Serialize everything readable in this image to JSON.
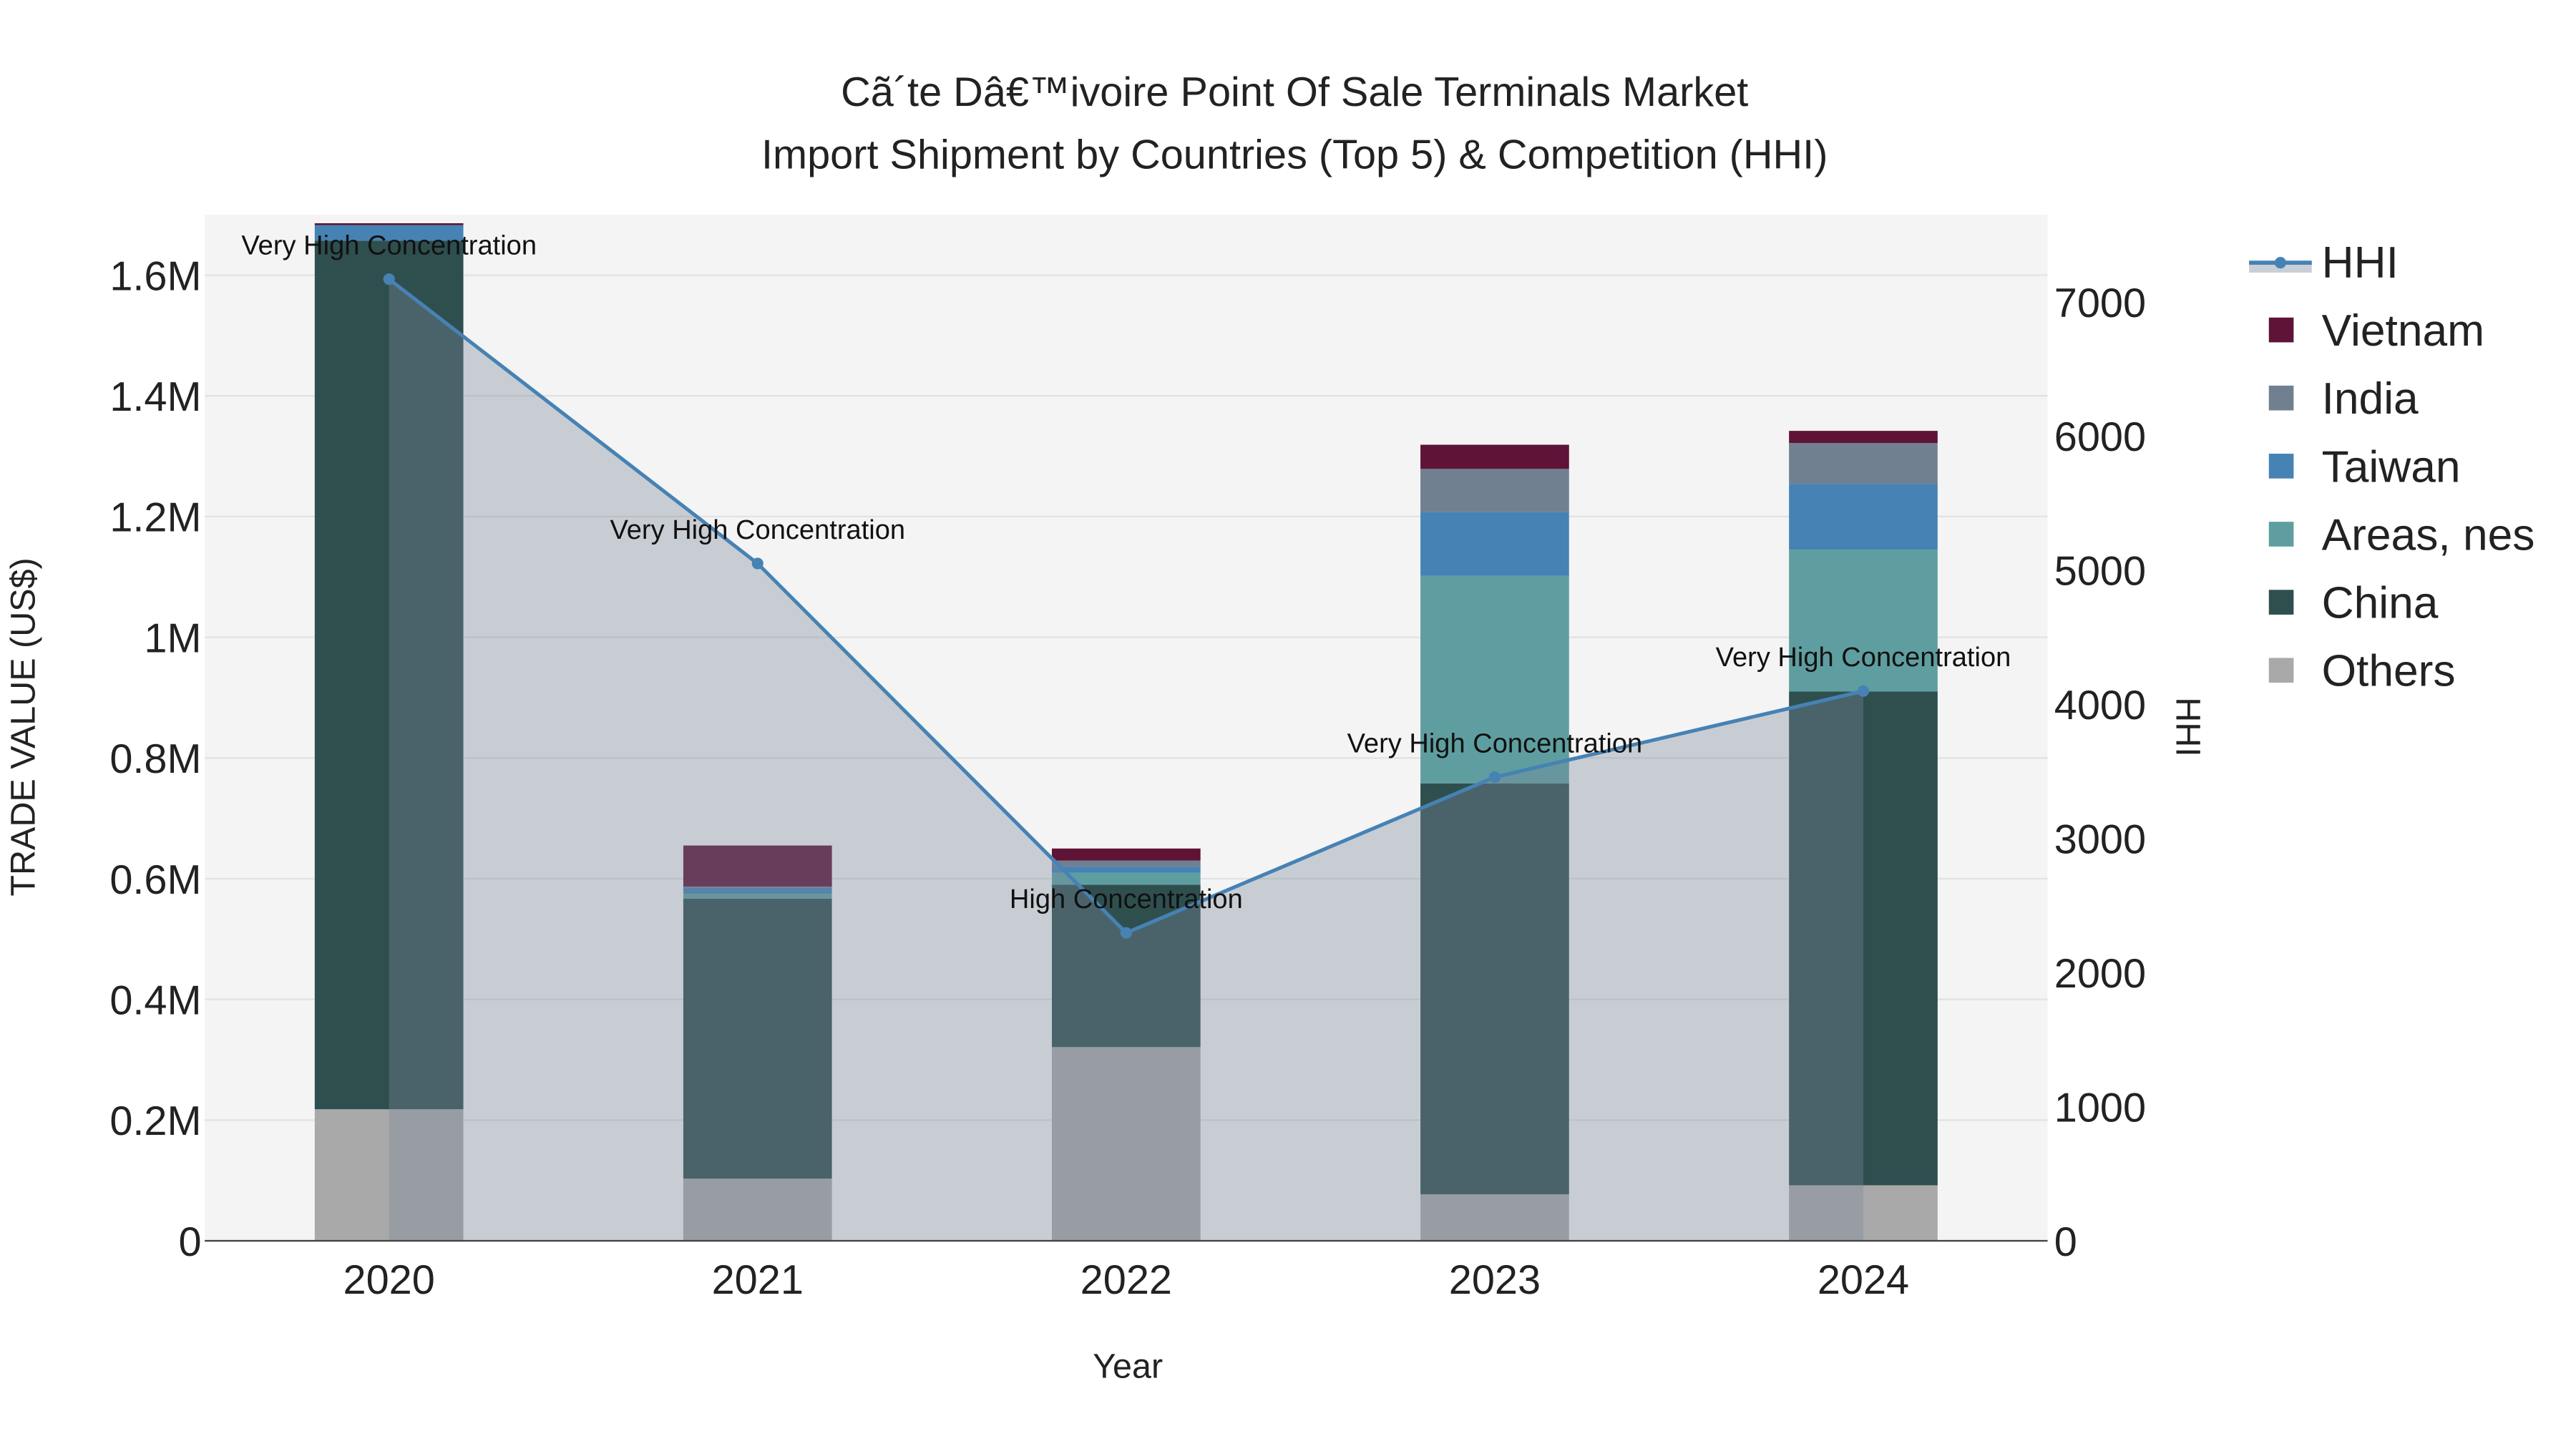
{
  "chart_data": {
    "type": "bar",
    "title_line1": "Cã´te Dâ€™ivoire Point Of Sale Terminals Market",
    "title_line2": "Import Shipment by Countries (Top 5) & Competition (HHI)",
    "xlabel": "Year",
    "ylabel": "TRADE VALUE (US$)",
    "y2label": "HHI",
    "categories": [
      "2020",
      "2021",
      "2022",
      "2023",
      "2024"
    ],
    "ylim": [
      0,
      1700000
    ],
    "y2lim": [
      0,
      7650
    ],
    "yticks": [
      {
        "v": 0,
        "label": "0"
      },
      {
        "v": 200000,
        "label": "0.2M"
      },
      {
        "v": 400000,
        "label": "0.4M"
      },
      {
        "v": 600000,
        "label": "0.6M"
      },
      {
        "v": 800000,
        "label": "0.8M"
      },
      {
        "v": 1000000,
        "label": "1M"
      },
      {
        "v": 1200000,
        "label": "1.2M"
      },
      {
        "v": 1400000,
        "label": "1.4M"
      },
      {
        "v": 1600000,
        "label": "1.6M"
      }
    ],
    "y2ticks": [
      {
        "v": 0,
        "label": "0"
      },
      {
        "v": 1000,
        "label": "1000"
      },
      {
        "v": 2000,
        "label": "2000"
      },
      {
        "v": 3000,
        "label": "3000"
      },
      {
        "v": 4000,
        "label": "4000"
      },
      {
        "v": 5000,
        "label": "5000"
      },
      {
        "v": 6000,
        "label": "6000"
      },
      {
        "v": 7000,
        "label": "7000"
      }
    ],
    "series": [
      {
        "name": "Others",
        "color": "#a9a9a9",
        "values": [
          218000,
          103000,
          321000,
          77000,
          92000
        ]
      },
      {
        "name": "China",
        "color": "#2f4f4f",
        "values": [
          1439000,
          464000,
          269000,
          681000,
          818000
        ]
      },
      {
        "name": "Areas, nes",
        "color": "#5f9ea0",
        "values": [
          0,
          8000,
          20000,
          344000,
          235000
        ]
      },
      {
        "name": "Taiwan",
        "color": "#4682b4",
        "values": [
          26000,
          10000,
          10000,
          106000,
          109000
        ]
      },
      {
        "name": "India",
        "color": "#708090",
        "values": [
          0,
          2000,
          10000,
          71000,
          68000
        ]
      },
      {
        "name": "Vietnam",
        "color": "#5f1337",
        "values": [
          3000,
          68000,
          20000,
          40000,
          20000
        ]
      }
    ],
    "hhi": {
      "name": "HHI",
      "color": "#4682b4",
      "values": [
        7170,
        5050,
        2296,
        3457,
        4099
      ],
      "labels": [
        "Very High Concentration",
        "Very High Concentration",
        "High Concentration",
        "Very High Concentration",
        "Very High Concentration"
      ]
    },
    "legend": [
      "HHI",
      "Vietnam",
      "India",
      "Taiwan",
      "Areas, nes",
      "China",
      "Others"
    ],
    "legend_placement": "right"
  }
}
